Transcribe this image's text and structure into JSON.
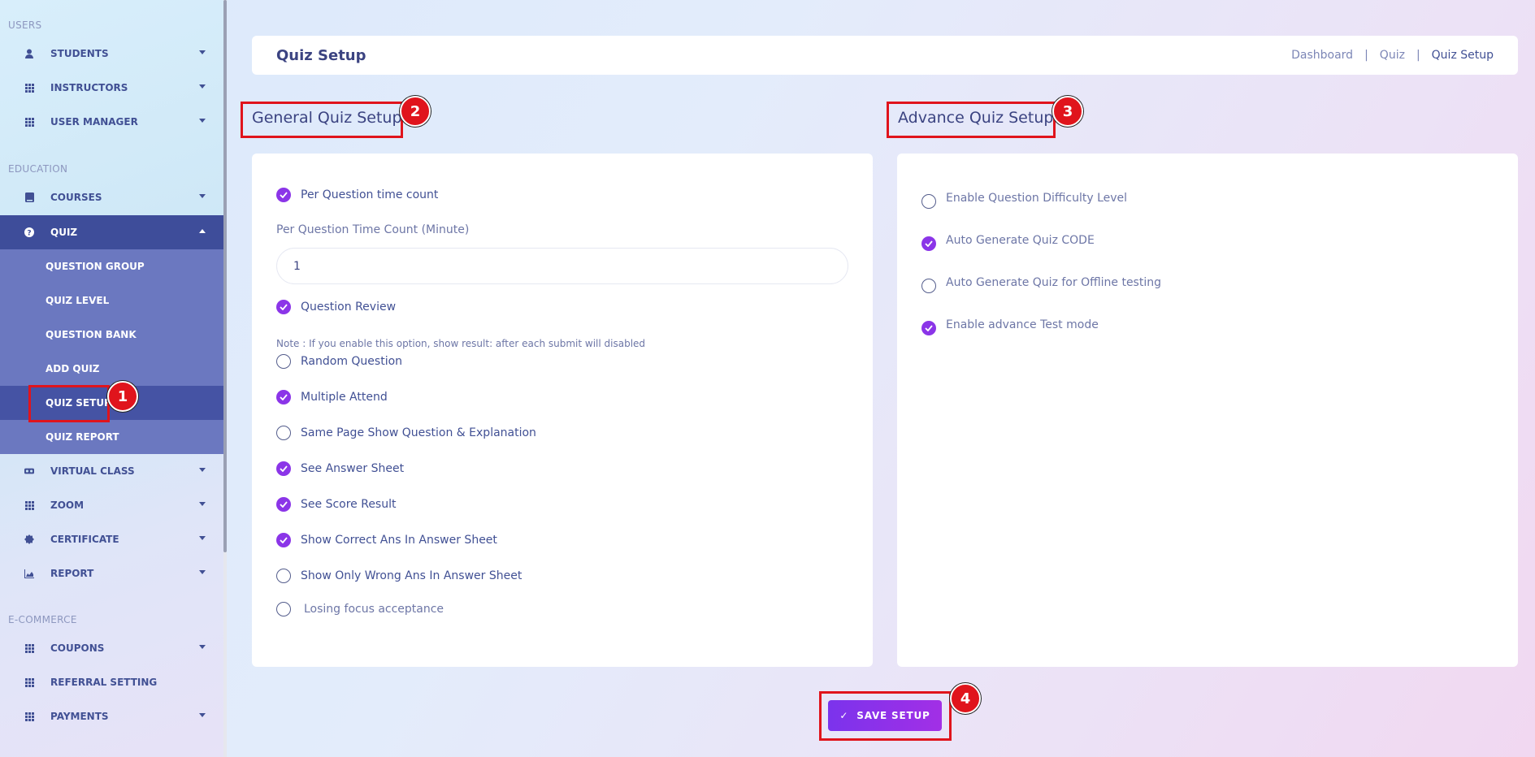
{
  "sidebar": {
    "sections": {
      "users": "USERS",
      "education": "EDUCATION",
      "ecommerce": "E-COMMERCE"
    },
    "items": {
      "students": "STUDENTS",
      "instructors": "INSTRUCTORS",
      "user_manager": "USER MANAGER",
      "courses": "COURSES",
      "quiz": "QUIZ",
      "virtual_class": "VIRTUAL CLASS",
      "zoom": "ZOOM",
      "certificate": "CERTIFICATE",
      "report": "REPORT",
      "coupons": "COUPONS",
      "referral_setting": "REFERRAL SETTING",
      "payments": "PAYMENTS"
    },
    "quiz_submenu": {
      "question_group": "QUESTION GROUP",
      "quiz_level": "QUIZ LEVEL",
      "question_bank": "QUESTION BANK",
      "add_quiz": "ADD QUIZ",
      "quiz_setup": "QUIZ SETUP",
      "quiz_report": "QUIZ REPORT"
    }
  },
  "header": {
    "title": "Quiz Setup",
    "breadcrumb": [
      "Dashboard",
      "Quiz",
      "Quiz Setup"
    ],
    "separator": "|"
  },
  "general": {
    "heading": "General Quiz Setup",
    "per_question_time": "Per Question time count",
    "time_count_label": "Per Question Time Count (Minute)",
    "time_count_value": "1",
    "question_review": "Question Review",
    "note": "Note : If you enable this option, show result: after each submit will disabled",
    "random_question": "Random Question",
    "multiple_attend": "Multiple Attend",
    "same_page": "Same Page Show Question & Explanation",
    "see_answer_sheet": "See Answer Sheet",
    "see_score_result": "See Score Result",
    "show_correct": "Show Correct Ans In Answer Sheet",
    "show_wrong": "Show Only Wrong Ans In Answer Sheet",
    "losing_focus": "Losing focus acceptance"
  },
  "advance": {
    "heading": "Advance Quiz Setup",
    "difficulty": "Enable Question Difficulty Level",
    "auto_code": "Auto Generate Quiz CODE",
    "offline": "Auto Generate Quiz for Offline testing",
    "test_mode": "Enable advance Test mode"
  },
  "actions": {
    "save": "SAVE SETUP",
    "save_icon": "✓"
  },
  "annotations": [
    "1",
    "2",
    "3",
    "4"
  ],
  "colors": {
    "accent": "#8b35e8",
    "sidebar_active": "#3e4d9a",
    "submenu": "#6b78c0",
    "highlight": "#e0141c"
  }
}
